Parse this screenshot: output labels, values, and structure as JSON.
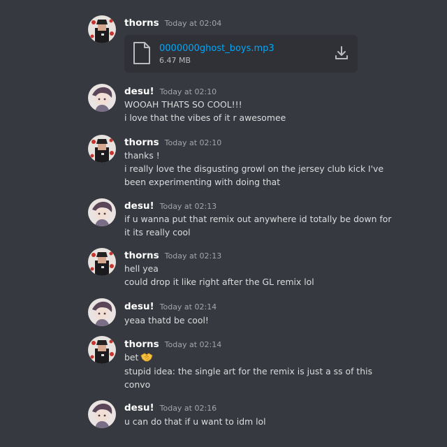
{
  "messages": [
    {
      "author": "thorns",
      "timestamp": "Today at 02:04",
      "attachment": {
        "file_name": "0000000ghost_boys.mp3",
        "file_size": "6.47 MB"
      }
    },
    {
      "author": "desu!",
      "timestamp": "Today at 02:10",
      "lines": [
        "WOOAH THATS SO COOL!!!",
        "i love that the vibes of it r awesomee"
      ]
    },
    {
      "author": "thorns",
      "timestamp": "Today at 02:10",
      "lines": [
        "thanks !",
        "i really love the disgusting growl on the jersey club kick I've",
        "been experimenting with doing that"
      ]
    },
    {
      "author": "desu!",
      "timestamp": "Today at 02:13",
      "lines": [
        "if u wanna put that remix out anywhere id totally be down for",
        "it its really cool"
      ]
    },
    {
      "author": "thorns",
      "timestamp": "Today at 02:13",
      "lines": [
        "hell yea",
        "could drop it like right after the GL remix lol"
      ]
    },
    {
      "author": "desu!",
      "timestamp": "Today at 02:14",
      "lines": [
        "yeaa thatd be cool!"
      ]
    },
    {
      "author": "thorns",
      "timestamp": "Today at 02:14",
      "lines": [
        "bet",
        "stupid idea: the single art for the remix is just a ss of this",
        "convo"
      ],
      "emoji": "handshake-emoji"
    },
    {
      "author": "desu!",
      "timestamp": "Today at 02:16",
      "lines": [
        "u can do that if u want to idm lol"
      ]
    }
  ],
  "colors": {
    "background": "#36393f",
    "attachment_bg": "#2f3136",
    "link": "#00a8fc",
    "username": "#ffffff",
    "timestamp": "#a3a6aa",
    "text": "#dcddde"
  }
}
